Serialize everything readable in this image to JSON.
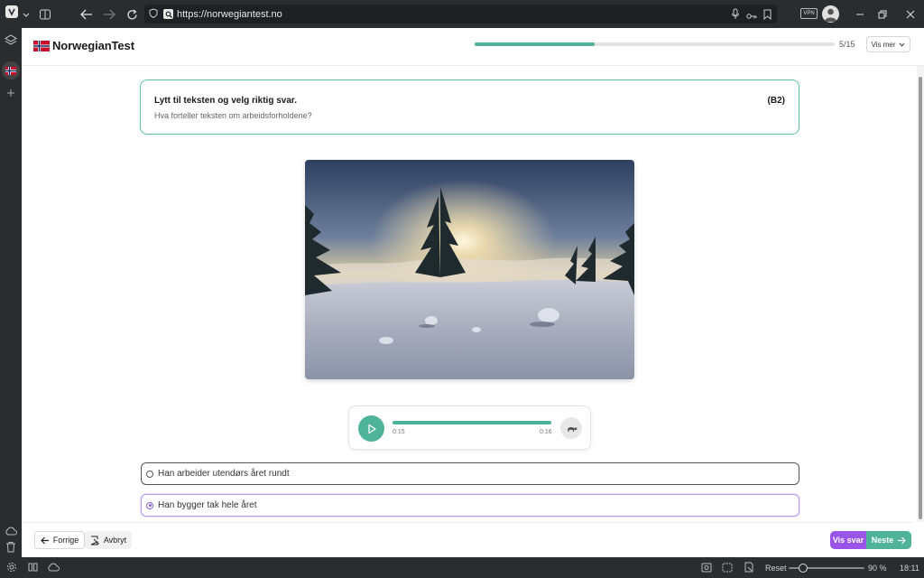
{
  "browser": {
    "url": "https://norwegiantest.no",
    "vpn_label": "VPN"
  },
  "header": {
    "logo_text": "NorwegianTest",
    "progress_fraction": 0.333,
    "progress_text": "5/15",
    "vismer_label": "Vis mer"
  },
  "question": {
    "instruction": "Lytt til teksten og velg riktig svar.",
    "prompt": "Hva forteller teksten om arbeidsforholdene?",
    "level": "(B2)"
  },
  "audio": {
    "current_time": "0:15",
    "duration": "0:16",
    "progress_fraction": 0.94
  },
  "options": [
    {
      "label": "Han arbeider utendørs året rundt",
      "selected": false
    },
    {
      "label": "Han bygger tak hele året",
      "selected": true
    }
  ],
  "footer": {
    "back_label": "Forrige",
    "cancel_label": "Avbryt",
    "show_answer_label": "Vis svar",
    "next_label": "Neste"
  },
  "statusbar": {
    "reset_label": "Reset",
    "zoom": "90 %",
    "time": "18:11"
  },
  "colors": {
    "accent_green": "#4fb39a",
    "accent_purple": "#9a55e8",
    "chrome": "#2b2c30"
  }
}
